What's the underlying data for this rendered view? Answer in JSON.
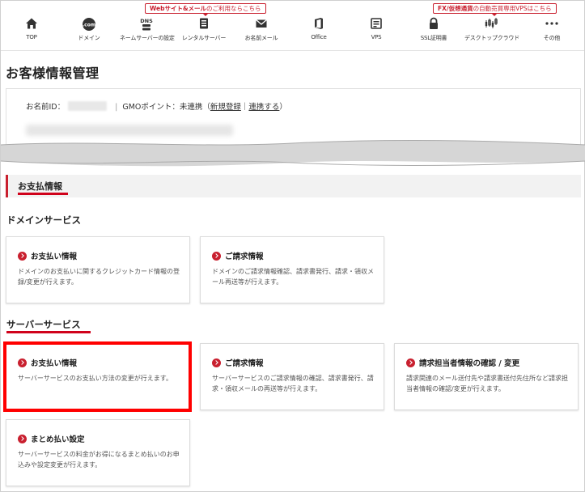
{
  "nav": {
    "items": [
      {
        "label": "TOP",
        "icon": "home-icon"
      },
      {
        "label": "ドメイン",
        "icon": "domain-com-icon",
        "icon_text": ".com"
      },
      {
        "label": "ネームサーバーの設定",
        "icon": "dns-icon",
        "icon_text": "DNS"
      },
      {
        "label": "レンタルサーバー",
        "icon": "server-icon"
      },
      {
        "label": "お名前メール",
        "icon": "mail-icon"
      },
      {
        "label": "Office",
        "icon": "office-icon"
      },
      {
        "label": "VPS",
        "icon": "vps-icon"
      },
      {
        "label": "SSL証明書",
        "icon": "lock-icon"
      },
      {
        "label": "デスクトップクラウド",
        "icon": "candlestick-icon"
      },
      {
        "label": "その他",
        "icon": "more-icon"
      }
    ],
    "promo_web": {
      "bold": "Webサイト&メール",
      "rest": "のご利用ならこちら"
    },
    "promo_fx": {
      "bold": "FX/仮想通貨",
      "rest": "の自動売買専用VPSはこちら"
    }
  },
  "page_title": "お客様情報管理",
  "account": {
    "name_id_label": "お名前ID：",
    "gmo_point_label": "GMOポイント：未連携（",
    "new_register": "新規登録",
    "divider": "｜",
    "link_account": "連携する",
    "close_paren": "）"
  },
  "payment": {
    "section_title": "お支払情報",
    "domain_service": {
      "title": "ドメインサービス",
      "cards": [
        {
          "title": "お支払い情報",
          "desc": "ドメインのお支払いに関するクレジットカード情報の登録/変更が行えます。"
        },
        {
          "title": "ご請求情報",
          "desc": "ドメインのご請求情報確認、請求書発行、請求・領収メール再送等が行えます。"
        }
      ]
    },
    "server_service": {
      "title": "サーバーサービス",
      "cards": [
        {
          "title": "お支払い情報",
          "desc": "サーバーサービスのお支払い方法の変更が行えます。"
        },
        {
          "title": "ご請求情報",
          "desc": "サーバーサービスのご請求情報の確認、請求書発行、請求・領収メールの再送等が行えます。"
        },
        {
          "title": "請求担当者情報の確認 / 変更",
          "desc": "請求関連のメール送付先や請求書送付先住所など請求担当者情報の確認/変更が行えます。"
        },
        {
          "title": "まとめ払い設定",
          "desc": "サーバーサービスの料金がお得になるまとめ払いのお申込みや設定変更が行えます。"
        }
      ]
    }
  },
  "colors": {
    "accent": "#c9202f",
    "highlight": "#ff0000"
  }
}
